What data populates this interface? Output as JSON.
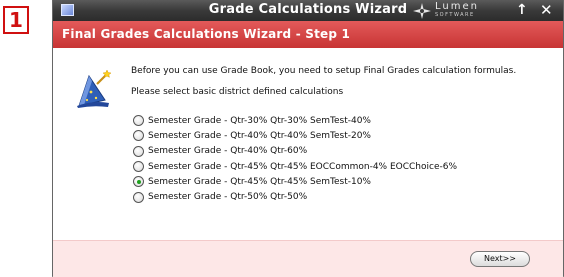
{
  "step_badge": "1",
  "window": {
    "title": "Grade Calculations Wizard",
    "brand_logo": {
      "name": "Lumen",
      "sub": "SOFTWARE"
    },
    "pin_symbol": "↑",
    "close_symbol": "✕"
  },
  "header": {
    "title": "Final Grades Calculations Wizard - Step 1"
  },
  "content": {
    "icon": "wizard-hat-icon",
    "intro_text": "Before you can use Grade Book, you need to setup Final Grades calculation formulas.",
    "select_prompt": "Please select basic district defined calculations",
    "options": [
      {
        "label": "Semester Grade - Qtr-30% Qtr-30% SemTest-40%",
        "selected": false
      },
      {
        "label": "Semester Grade - Qtr-40% Qtr-40% SemTest-20%",
        "selected": false
      },
      {
        "label": "Semester Grade - Qtr-40% Qtr-60%",
        "selected": false
      },
      {
        "label": "Semester Grade - Qtr-45% Qtr-45% EOCCommon-4% EOCChoice-6%",
        "selected": false
      },
      {
        "label": "Semester Grade - Qtr-45% Qtr-45% SemTest-10%",
        "selected": true
      },
      {
        "label": "Semester Grade - Qtr-50% Qtr-50%",
        "selected": false
      }
    ]
  },
  "footer": {
    "next_label": "Next>>"
  },
  "colors": {
    "badge_red": "#d01010",
    "header_red": "#d54646",
    "footer_pink": "#fde7e7",
    "titlebar_dark": "#3a3a3a",
    "radio_selected": "#1fa11f"
  }
}
